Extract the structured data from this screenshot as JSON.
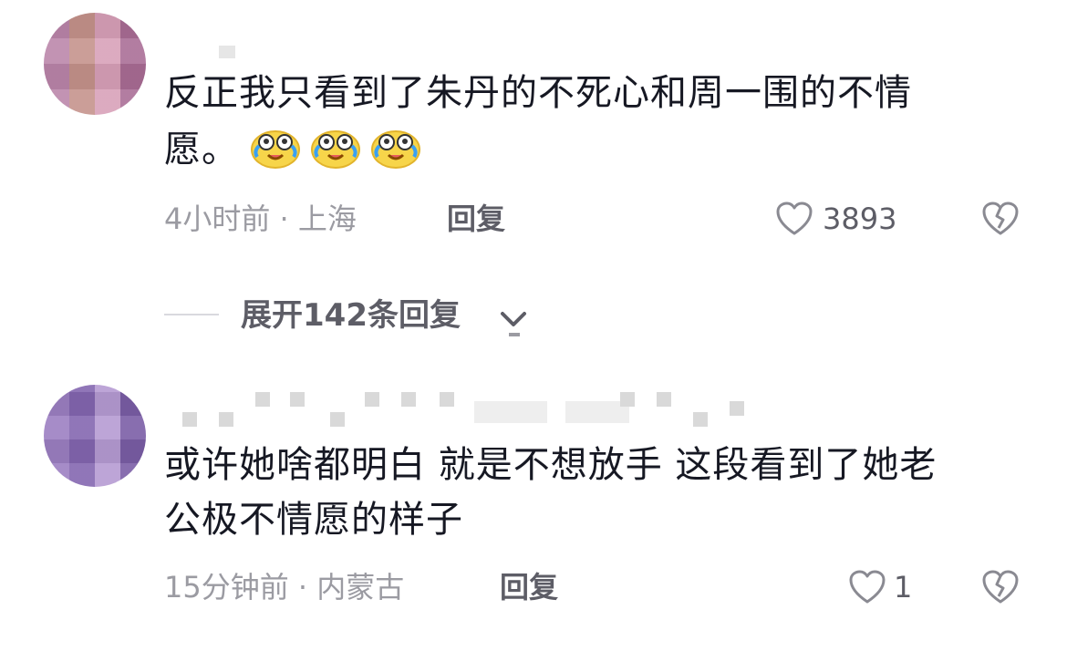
{
  "comments": [
    {
      "text_line1": "反正我只看到了朱丹的不死心和周一围的不情",
      "text_line2": "愿。",
      "emoji": [
        "crying-laughing-emoji",
        "crying-laughing-emoji",
        "crying-laughing-emoji"
      ],
      "time_location": "4小时前 · 上海",
      "reply_label": "回复",
      "like_count": "3893"
    },
    {
      "text_line1": "或许她啥都明白 就是不想放手 这段看到了她老",
      "text_line2": "公极不情愿的样子",
      "time_location": "15分钟前 · 内蒙古",
      "reply_label": "回复",
      "like_count": "1"
    }
  ],
  "expand_replies": "展开142条回复",
  "colors": {
    "text": "#161823",
    "meta": "#9b9ba2",
    "action": "#5d5d66"
  },
  "icons": [
    "heart-icon",
    "dislike-icon",
    "chevron-down-icon"
  ]
}
